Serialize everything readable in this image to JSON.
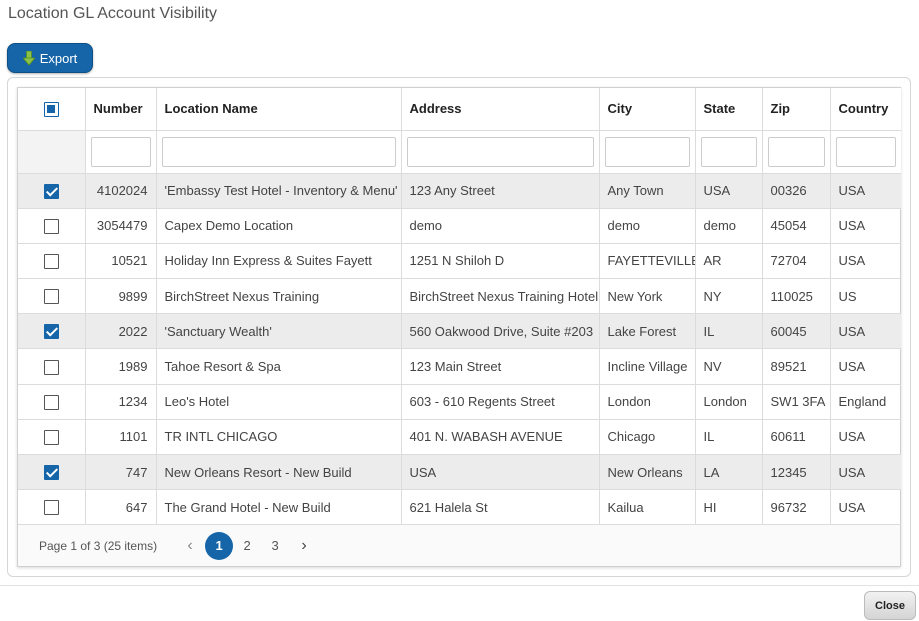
{
  "dialog": {
    "title": "Location GL Account Visibility",
    "export_label": "Export",
    "close_label": "Close"
  },
  "grid": {
    "columns": [
      "Number",
      "Location Name",
      "Address",
      "City",
      "State",
      "Zip",
      "Country"
    ],
    "rows": [
      {
        "checked": true,
        "number": "4102024",
        "name": "'Embassy Test Hotel - Inventory & Menu'",
        "address": "123 Any Street",
        "city": "Any Town",
        "state": "USA",
        "zip": "00326",
        "country": "USA"
      },
      {
        "checked": false,
        "number": "3054479",
        "name": "Capex Demo Location",
        "address": "demo",
        "city": "demo",
        "state": "demo",
        "zip": "45054",
        "country": "USA"
      },
      {
        "checked": false,
        "number": "10521",
        "name": "Holiday Inn Express & Suites Fayett",
        "address": "1251 N Shiloh D",
        "city": "FAYETTEVILLE",
        "state": "AR",
        "zip": "72704",
        "country": "USA"
      },
      {
        "checked": false,
        "number": "9899",
        "name": "BirchStreet Nexus Training",
        "address": "BirchStreet Nexus Training Hotel",
        "city": "New York",
        "state": "NY",
        "zip": "110025",
        "country": "US"
      },
      {
        "checked": true,
        "number": "2022",
        "name": "'Sanctuary Wealth'",
        "address": "560 Oakwood Drive, Suite #203",
        "city": "Lake Forest",
        "state": "IL",
        "zip": "60045",
        "country": "USA"
      },
      {
        "checked": false,
        "number": "1989",
        "name": "Tahoe Resort & Spa",
        "address": "123 Main Street",
        "city": "Incline Village",
        "state": "NV",
        "zip": "89521",
        "country": "USA"
      },
      {
        "checked": false,
        "number": "1234",
        "name": "Leo's Hotel",
        "address": "603 - 610 Regents Street",
        "city": "London",
        "state": "London",
        "zip": "SW1 3FA",
        "country": "England"
      },
      {
        "checked": false,
        "number": "1101",
        "name": "TR INTL CHICAGO",
        "address": "401 N. WABASH AVENUE",
        "city": "Chicago",
        "state": "IL",
        "zip": "60611",
        "country": "USA"
      },
      {
        "checked": true,
        "number": "747",
        "name": "New Orleans Resort - New Build",
        "address": "USA",
        "city": "New Orleans",
        "state": "LA",
        "zip": "12345",
        "country": "USA"
      },
      {
        "checked": false,
        "number": "647",
        "name": "The Grand Hotel - New Build",
        "address": "621 Halela St",
        "city": "Kailua",
        "state": "HI",
        "zip": "96732",
        "country": "USA"
      }
    ]
  },
  "pager": {
    "info": "Page 1 of 3 (25 items)",
    "pages": [
      "1",
      "2",
      "3"
    ],
    "current": "1",
    "prev_icon": "chevron-left-icon",
    "next_icon": "chevron-right-icon"
  },
  "colors": {
    "accent": "#1565a8",
    "selected_row": "#ececec"
  }
}
